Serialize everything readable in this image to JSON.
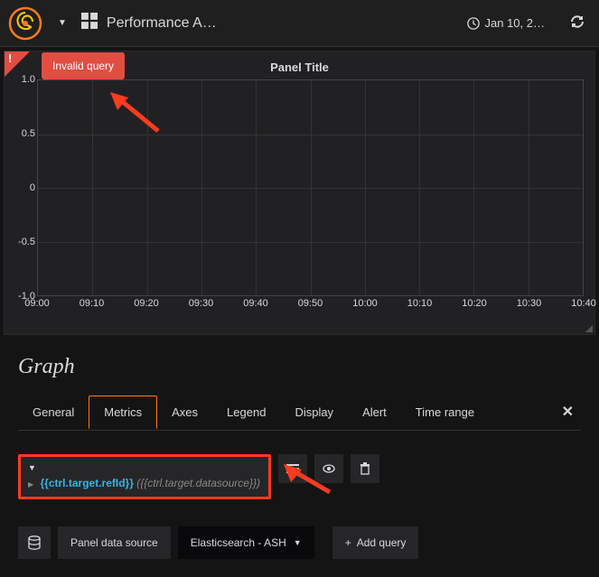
{
  "header": {
    "dashboard_title": "Performance A…",
    "time_range": "Jan 10, 2…"
  },
  "panel": {
    "title": "Panel Title",
    "error_tooltip": "Invalid query"
  },
  "chart_data": {
    "type": "line",
    "title": "Panel Title",
    "ylim": [
      -1.0,
      1.0
    ],
    "y_ticks": [
      1.0,
      0.5,
      0,
      -0.5,
      -1.0
    ],
    "x_ticks": [
      "09:00",
      "09:10",
      "09:20",
      "09:30",
      "09:40",
      "09:50",
      "10:00",
      "10:10",
      "10:20",
      "10:30",
      "10:40"
    ],
    "series": []
  },
  "editor": {
    "title": "Graph",
    "tabs": [
      "General",
      "Metrics",
      "Axes",
      "Legend",
      "Display",
      "Alert",
      "Time range"
    ],
    "active_tab": "Metrics"
  },
  "query": {
    "refid_template": "{{ctrl.target.refId}}",
    "datasource_template": "({{ctrl.target.datasource}})"
  },
  "datasource": {
    "label": "Panel data source",
    "selected": "Elasticsearch - ASH",
    "add_query": "Add query"
  }
}
